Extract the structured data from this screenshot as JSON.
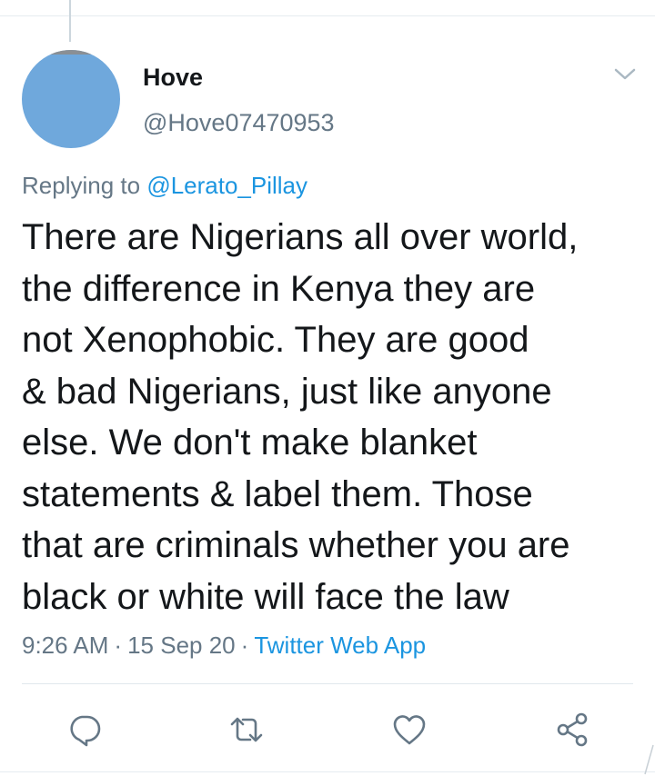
{
  "tweet": {
    "author": {
      "display_name": "Hove",
      "handle": "@Hove07470953",
      "avatar_color": "#6fa8dc"
    },
    "reply": {
      "prefix": "Replying to",
      "mention": "@Lerato_Pillay"
    },
    "text_lines": [
      "There are Nigerians all over world,",
      "the difference in Kenya they are",
      "not Xenophobic. They are good",
      "& bad Nigerians, just like anyone",
      "else. We don't make blanket",
      "statements & label them. Those",
      "that are criminals whether you are",
      "black or white will face the law"
    ],
    "meta": {
      "time": "9:26 AM",
      "separator": "·",
      "date": "15 Sep 20",
      "source": "Twitter Web App"
    }
  },
  "actions": [
    {
      "name": "reply",
      "icon": "reply-icon"
    },
    {
      "name": "retweet",
      "icon": "retweet-icon"
    },
    {
      "name": "like",
      "icon": "heart-icon"
    },
    {
      "name": "share",
      "icon": "share-icon"
    }
  ],
  "colors": {
    "text": "#14171a",
    "secondary": "#657786",
    "link": "#1b95e0",
    "icon": "#657786",
    "divider": "#e1e8ed"
  }
}
